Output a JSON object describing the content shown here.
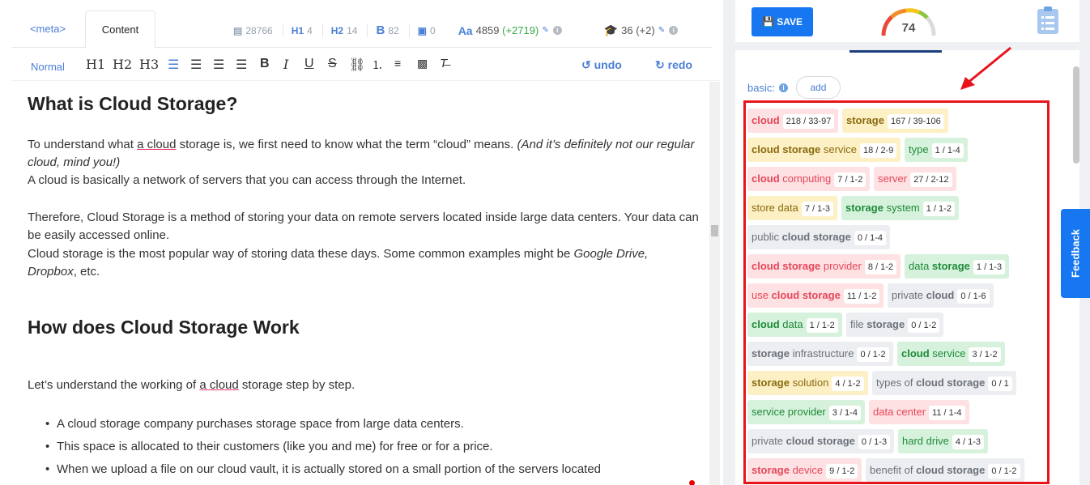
{
  "tabs": {
    "meta": "<meta>",
    "content": "Content"
  },
  "stats": {
    "images_words": "28766",
    "h1": "4",
    "h2": "14",
    "bold": "82",
    "img": "0",
    "words": "4859",
    "words_delta": "(+2719)",
    "grade": "36 (+2)"
  },
  "toolbar": {
    "normal": "Normal",
    "h1": "H1",
    "h2": "H2",
    "h3": "H3",
    "undo": "undo",
    "redo": "redo"
  },
  "article": {
    "h_what": "What is Cloud Storage?",
    "p1a": "To understand what ",
    "p1kw": "a cloud",
    "p1b": " storage is, we first need to know what the term “cloud” means. ",
    "p1i": "(And it’s definitely not our regular cloud, mind you!)",
    "p2": "A cloud is basically a network of servers that you can access through the Internet.",
    "p3": "Therefore, Cloud Storage is a method of storing your data on remote servers located inside large data centers. Your data can be easily accessed online.",
    "p4a": "Cloud storage is the most popular way of storing data these days. Some common examples might be ",
    "p4i": "Google Drive, Dropbox",
    "p4b": ", etc.",
    "h_how": "How does Cloud Storage Work",
    "p5a": "Let’s understand the working of ",
    "p5kw": "a cloud",
    "p5b": " storage step by step.",
    "bullets": [
      "A cloud storage company purchases storage space from large data centers.",
      "This space is allocated to their customers (like you and me) for free or for a price.",
      "When we upload a file on our cloud vault, it is actually stored on a small portion of the servers located"
    ]
  },
  "panel": {
    "save": "SAVE",
    "score": "74",
    "basic": "basic:",
    "add": "add",
    "feedback": "Feedback"
  },
  "keywords": [
    {
      "pre": "",
      "bold": "cloud",
      "post": "",
      "cnt": "218 / 33-97",
      "color": "red"
    },
    {
      "pre": "",
      "bold": "storage",
      "post": "",
      "cnt": "167 / 39-106",
      "color": "yel"
    },
    {
      "pre": "",
      "bold": "cloud storage",
      "post": " service",
      "cnt": "18 / 2-9",
      "color": "yel"
    },
    {
      "pre": "type",
      "bold": "",
      "post": "",
      "cnt": "1 / 1-4",
      "color": "grn"
    },
    {
      "pre": "",
      "bold": "cloud",
      "post": " computing",
      "cnt": "7 / 1-2",
      "color": "red"
    },
    {
      "pre": "server",
      "bold": "",
      "post": "",
      "cnt": "27 / 2-12",
      "color": "red"
    },
    {
      "pre": "store data",
      "bold": "",
      "post": "",
      "cnt": "7 / 1-3",
      "color": "yel"
    },
    {
      "pre": "",
      "bold": "storage",
      "post": " system",
      "cnt": "1 / 1-2",
      "color": "grn"
    },
    {
      "pre": "public ",
      "bold": "cloud storage",
      "post": "",
      "cnt": "0 / 1-4",
      "color": "gry"
    },
    {
      "pre": "",
      "bold": "cloud storage",
      "post": " provider",
      "cnt": "8 / 1-2",
      "color": "red"
    },
    {
      "pre": "data ",
      "bold": "storage",
      "post": "",
      "cnt": "1 / 1-3",
      "color": "grn"
    },
    {
      "pre": "use ",
      "bold": "cloud storage",
      "post": "",
      "cnt": "11 / 1-2",
      "color": "red"
    },
    {
      "pre": "private ",
      "bold": "cloud",
      "post": "",
      "cnt": "0 / 1-6",
      "color": "gry"
    },
    {
      "pre": "",
      "bold": "cloud",
      "post": " data",
      "cnt": "1 / 1-2",
      "color": "grn"
    },
    {
      "pre": "file ",
      "bold": "storage",
      "post": "",
      "cnt": "0 / 1-2",
      "color": "gry"
    },
    {
      "pre": "",
      "bold": "storage",
      "post": " infrastructure",
      "cnt": "0 / 1-2",
      "color": "gry"
    },
    {
      "pre": "",
      "bold": "cloud",
      "post": " service",
      "cnt": "3 / 1-2",
      "color": "grn"
    },
    {
      "pre": "",
      "bold": "storage",
      "post": " solution",
      "cnt": "4 / 1-2",
      "color": "yel"
    },
    {
      "pre": "types of ",
      "bold": "cloud storage",
      "post": "",
      "cnt": "0 / 1",
      "color": "gry"
    },
    {
      "pre": "service provider",
      "bold": "",
      "post": "",
      "cnt": "3 / 1-4",
      "color": "grn"
    },
    {
      "pre": "data center",
      "bold": "",
      "post": "",
      "cnt": "11 / 1-4",
      "color": "red"
    },
    {
      "pre": "private ",
      "bold": "cloud storage",
      "post": "",
      "cnt": "0 / 1-3",
      "color": "gry"
    },
    {
      "pre": "hard drive",
      "bold": "",
      "post": "",
      "cnt": "4 / 1-3",
      "color": "grn"
    },
    {
      "pre": "",
      "bold": "storage",
      "post": " device",
      "cnt": "9 / 1-2",
      "color": "red"
    },
    {
      "pre": "benefit of ",
      "bold": "cloud storage",
      "post": "",
      "cnt": "0 / 1-2",
      "color": "gry"
    }
  ]
}
